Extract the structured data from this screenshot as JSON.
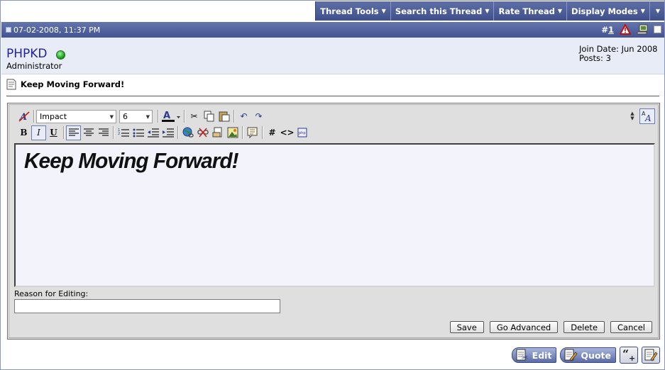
{
  "topbar": {
    "tools": [
      "Thread Tools",
      "Search this Thread",
      "Rate Thread",
      "Display Modes"
    ]
  },
  "post": {
    "date": "07-02-2008, 11:37 PM",
    "number_prefix": "#",
    "number": "1",
    "user": {
      "name": "PHPKD",
      "role": "Administrator",
      "status": "online",
      "join_date": "Join Date: Jun 2008",
      "posts": "Posts: 3"
    },
    "title": "Keep Moving Forward!"
  },
  "editor": {
    "font_name": "Impact",
    "font_size": "6",
    "content": "Keep Moving Forward!",
    "reason_label": "Reason for Editing:",
    "reason_value": "",
    "buttons": {
      "save": "Save",
      "go_advanced": "Go Advanced",
      "delete": "Delete",
      "cancel": "Cancel"
    }
  },
  "bottom": {
    "edit": "Edit",
    "quote": "Quote"
  },
  "colors": {
    "header_gradient_top": "#6475ac",
    "header_gradient_bottom": "#435394",
    "username": "#22229c",
    "online": "#1ea51e"
  }
}
